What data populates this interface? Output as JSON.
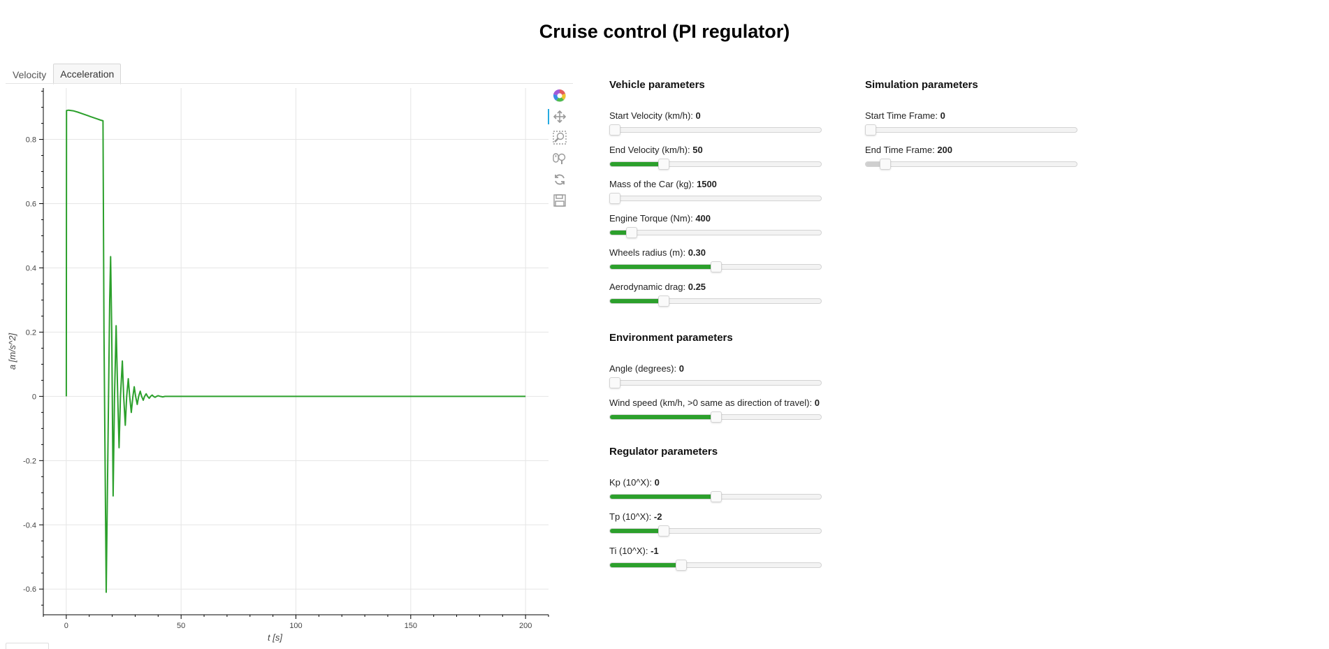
{
  "page": {
    "title": "Cruise control (PI regulator)"
  },
  "tabs": [
    {
      "label": "Velocity",
      "active": false
    },
    {
      "label": "Acceleration",
      "active": true
    }
  ],
  "toolbar": {
    "tools": [
      "bokeh-logo-icon",
      "pan-icon",
      "box-zoom-icon",
      "wheel-zoom-icon",
      "reset-icon",
      "save-icon"
    ],
    "active_tool": "pan-icon"
  },
  "chart_data": {
    "type": "line",
    "title": "",
    "xlabel": "t [s]",
    "ylabel": "a [m/s^2]",
    "xlim": [
      -10,
      210
    ],
    "ylim": [
      -0.68,
      0.96
    ],
    "x_ticks": [
      0,
      50,
      100,
      150,
      200
    ],
    "y_ticks": [
      -0.6,
      -0.4,
      -0.2,
      0,
      0.2,
      0.4,
      0.6,
      0.8
    ],
    "x_tick_labels": [
      "0",
      "50",
      "100",
      "150",
      "200"
    ],
    "y_tick_labels": [
      "-0.6",
      "-0.4",
      "-0.2",
      "0",
      "0.2",
      "0.4",
      "0.6",
      "0.8"
    ],
    "grid": true,
    "line_color": "#2ca02c",
    "series": [
      {
        "points": [
          [
            0,
            0
          ],
          [
            0.1,
            0.89
          ],
          [
            1,
            0.891
          ],
          [
            3,
            0.889
          ],
          [
            5,
            0.885
          ],
          [
            7,
            0.88
          ],
          [
            9,
            0.875
          ],
          [
            11,
            0.87
          ],
          [
            13,
            0.865
          ],
          [
            15,
            0.86
          ],
          [
            16,
            0.858
          ],
          [
            16.4,
            0.2
          ],
          [
            17.4,
            -0.61
          ],
          [
            17.9,
            -0.3
          ],
          [
            18.9,
            0.3
          ],
          [
            19.3,
            0.435
          ],
          [
            19.8,
            0.2
          ],
          [
            20.4,
            -0.31
          ],
          [
            21.0,
            0.0
          ],
          [
            21.7,
            0.22
          ],
          [
            22.4,
            0.0
          ],
          [
            23.0,
            -0.16
          ],
          [
            23.6,
            0.0
          ],
          [
            24.4,
            0.11
          ],
          [
            25.0,
            0.0
          ],
          [
            25.7,
            -0.09
          ],
          [
            26.3,
            0.0
          ],
          [
            27.0,
            0.055
          ],
          [
            27.6,
            0.0
          ],
          [
            28.3,
            -0.05
          ],
          [
            29.0,
            0.0
          ],
          [
            29.6,
            0.03
          ],
          [
            30.2,
            0.0
          ],
          [
            30.9,
            -0.025
          ],
          [
            31.5,
            0.0
          ],
          [
            32.2,
            0.016
          ],
          [
            32.8,
            0.0
          ],
          [
            33.5,
            -0.012
          ],
          [
            34.1,
            0.0
          ],
          [
            34.8,
            0.008
          ],
          [
            35.4,
            0.0
          ],
          [
            36.1,
            -0.006
          ],
          [
            36.7,
            0.0
          ],
          [
            37.4,
            0.004
          ],
          [
            38.0,
            0.0
          ],
          [
            38.7,
            -0.003
          ],
          [
            39.3,
            0.0
          ],
          [
            40.0,
            0.002
          ],
          [
            41.0,
            0.0
          ],
          [
            42.0,
            -0.0015
          ],
          [
            43.0,
            0.0
          ],
          [
            45.0,
            0.0
          ],
          [
            60.0,
            0.0
          ],
          [
            100.0,
            0.0
          ],
          [
            150.0,
            0.0
          ],
          [
            200.0,
            0.0
          ]
        ]
      }
    ]
  },
  "vehicle": {
    "title": "Vehicle parameters",
    "sliders": [
      {
        "label": "Start Velocity (km/h): ",
        "value": "0",
        "fraction": 0.0
      },
      {
        "label": "End Velocity (km/h): ",
        "value": "50",
        "fraction": 0.25
      },
      {
        "label": "Mass of the Car (kg): ",
        "value": "1500",
        "fraction": 0.0
      },
      {
        "label": "Engine Torque (Nm): ",
        "value": "400",
        "fraction": 0.1
      },
      {
        "label": "Wheels radius (m): ",
        "value": "0.30",
        "fraction": 0.5
      },
      {
        "label": "Aerodynamic drag: ",
        "value": "0.25",
        "fraction": 0.25
      }
    ]
  },
  "environment": {
    "title": "Environment parameters",
    "sliders": [
      {
        "label": "Angle (degrees): ",
        "value": "0",
        "fraction": 0.0
      },
      {
        "label": "Wind speed (km/h, >0 same as direction of travel): ",
        "value": "0",
        "fraction": 0.5
      }
    ]
  },
  "regulator": {
    "title": "Regulator parameters",
    "sliders": [
      {
        "label": "Kp (10^X): ",
        "value": "0",
        "fraction": 0.5
      },
      {
        "label": "Tp (10^X): ",
        "value": "-2",
        "fraction": 0.25
      },
      {
        "label": "Ti (10^X): ",
        "value": "-1",
        "fraction": 0.333
      }
    ]
  },
  "simulation": {
    "title": "Simulation parameters",
    "sliders": [
      {
        "label": "Start Time Frame: ",
        "value": "0",
        "fraction": 0.0
      },
      {
        "label": "End Time Frame: ",
        "value": "200",
        "fraction": 0.09
      }
    ]
  }
}
